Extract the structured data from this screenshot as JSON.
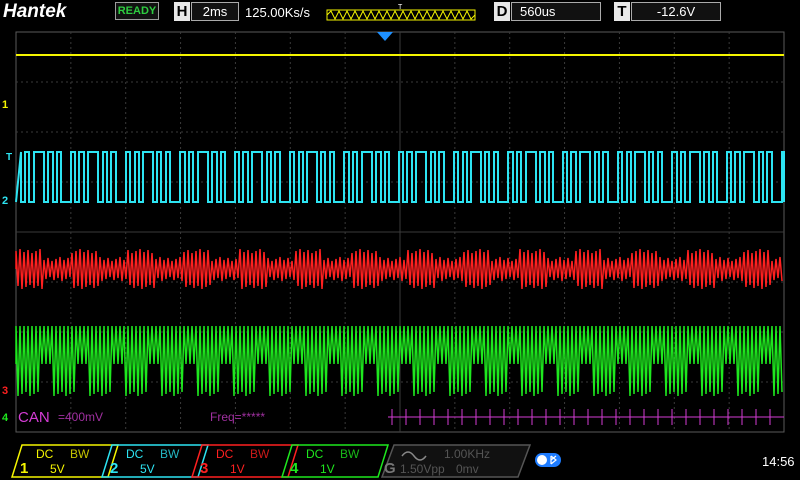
{
  "header": {
    "logo": "Hantek",
    "status": "READY",
    "horiz_label": "H",
    "timebase": "2ms",
    "sample_rate": "125.00Ks/s",
    "mem_marker": "T",
    "delay_label": "D",
    "delay": "560us",
    "trigger_label": "T",
    "trigger_level": "-12.6V"
  },
  "screen": {
    "ch4_decode_label": "CAN",
    "ch4_threshold": "=400mV",
    "freq_label": "Freq=*****",
    "markers": {
      "ch1": "1",
      "ch2": "2",
      "trig": "T",
      "ch3": "3",
      "ch4": "4"
    }
  },
  "channels": [
    {
      "num": "1",
      "coupling": "DC",
      "bw": "BW",
      "scale": "5V",
      "color": "#f5f500"
    },
    {
      "num": "2",
      "coupling": "DC",
      "bw": "BW",
      "scale": "5V",
      "color": "#2de4f2"
    },
    {
      "num": "3",
      "coupling": "DC",
      "bw": "BW",
      "scale": "1V",
      "color": "#ff2020"
    },
    {
      "num": "4",
      "coupling": "DC",
      "bw": "BW",
      "scale": "1V",
      "color": "#1ee81e"
    }
  ],
  "generator": {
    "label": "G",
    "freq": "1.00KHz",
    "amplitude": "1.50Vpp",
    "offset": "0mv"
  },
  "clock": "14:56",
  "colors": {
    "ch1": "#f5f500",
    "ch2": "#2de4f2",
    "ch3": "#ff2020",
    "ch4": "#1ee81e",
    "decode": "#d43cd4",
    "grid": "#3a3a3a"
  }
}
